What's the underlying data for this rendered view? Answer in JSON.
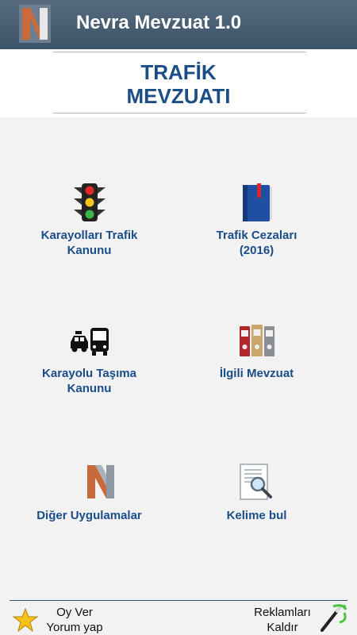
{
  "app_bar": {
    "title": "Nevra Mevzuat 1.0",
    "logo_icon": "nevra-logo-icon"
  },
  "header": {
    "title_line1": "TRAFİK",
    "title_line2": "MEVZUATI"
  },
  "menu": [
    {
      "label_line1": "Karayolları Trafik",
      "label_line2": "Kanunu",
      "icon": "traffic-light-icon"
    },
    {
      "label_line1": "Trafik Cezaları",
      "label_line2": "(2016)",
      "icon": "blue-book-icon"
    },
    {
      "label_line1": "Karayolu Taşıma",
      "label_line2": "Kanunu",
      "icon": "vehicles-icon"
    },
    {
      "label_line1": "İlgili Mevzuat",
      "label_line2": "",
      "icon": "binders-icon"
    },
    {
      "label_line1": "Diğer Uygulamalar",
      "label_line2": "",
      "icon": "nevra-logo-icon"
    },
    {
      "label_line1": "Kelime bul",
      "label_line2": "",
      "icon": "search-document-icon"
    }
  ],
  "footer": {
    "rate_line1": "Oy Ver",
    "rate_line2": "Yorum yap",
    "ads_line1": "Reklamları",
    "ads_line2": "Kaldır"
  },
  "colors": {
    "app_bar": "#4a5f74",
    "label_text": "#1a4d8a",
    "title_text": "#1c4d87"
  }
}
